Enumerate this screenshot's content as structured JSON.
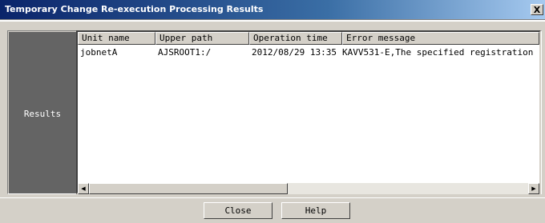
{
  "window": {
    "title": "Temporary Change Re-execution Processing Results",
    "close_glyph": "X"
  },
  "sidebar": {
    "label": "Results"
  },
  "table": {
    "columns": [
      "Unit name",
      "Upper path",
      "Operation time",
      "Error message"
    ],
    "rows": [
      [
        "jobnetA",
        "AJSROOT1:/",
        "2012/08/29 13:35",
        "KAVV531-E,The specified registration"
      ]
    ]
  },
  "scrollbar": {
    "left_arrow": "◀",
    "right_arrow": "▶"
  },
  "buttons": {
    "close": "Close",
    "help": "Help"
  }
}
